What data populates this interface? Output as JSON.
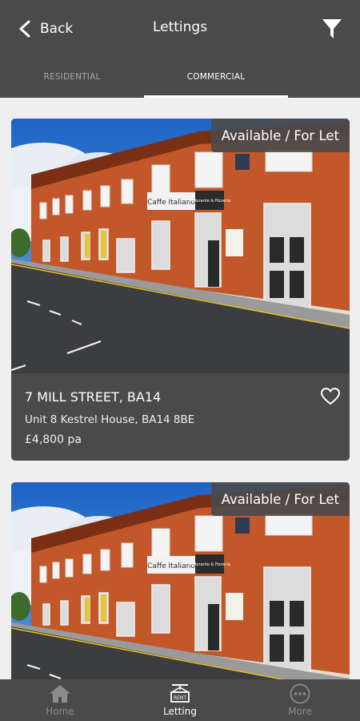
{
  "header": {
    "back_label": "Back",
    "title": "Lettings"
  },
  "tabs": [
    {
      "label": "RESIDENTIAL"
    },
    {
      "label": "COMMERCIAL"
    }
  ],
  "selected_tab": "COMMERCIAL",
  "listings": [
    {
      "status": "Available / For Let",
      "address": "7 MILL STREET, BA14",
      "subtitle": "Unit 8 Kestrel House, BA14 8BE",
      "price": "£4,800 pa",
      "signs": [
        "Caffe Italiano",
        "Ristorante & Pizzeria"
      ]
    },
    {
      "status": "Available / For Let",
      "address": "",
      "subtitle": "",
      "price": "",
      "signs": [
        "Caffe Italiano",
        "Ristorante & Pizzeria"
      ]
    }
  ],
  "bottom_nav": [
    {
      "label": "Home",
      "icon": "home-icon"
    },
    {
      "label": "Letting",
      "icon": "for-rent-sign-icon",
      "sign_text": "RENT"
    },
    {
      "label": "More",
      "icon": "more-dots-icon"
    }
  ],
  "selected_nav": "Letting",
  "colors": {
    "bar": "#4a4a4a",
    "background": "#efefef",
    "active_text": "#ffffff",
    "inactive_text": "#8c8c8c"
  }
}
